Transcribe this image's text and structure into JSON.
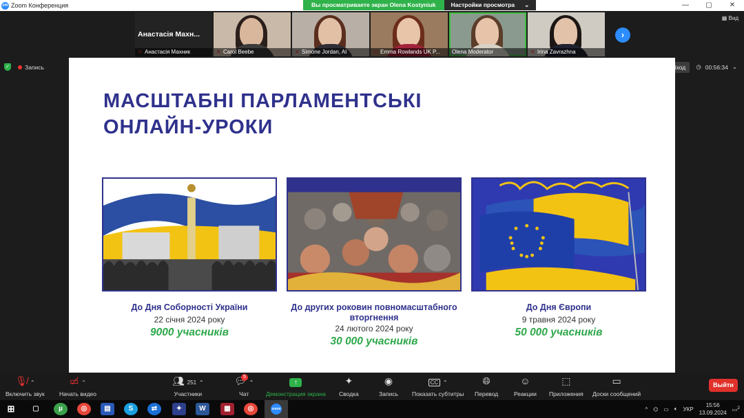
{
  "window": {
    "title": "Zoom Конференция",
    "controls": [
      "—",
      "▢",
      "✕"
    ]
  },
  "share_banner": {
    "viewing": "Вы просматриваете экран Olena Kostyniuk",
    "settings": "Настройки просмотра"
  },
  "gallery": {
    "host_card": "Анастасія Махн...",
    "tiles": [
      {
        "name": "Анастасія Махник",
        "muted": true
      },
      {
        "name": "Carol Beebe",
        "muted": true
      },
      {
        "name": "Simone Jordan, AI",
        "muted": true
      },
      {
        "name": "Emma Rowlands UK P...",
        "muted": true
      },
      {
        "name": "Olena Moderator",
        "muted": false
      },
      {
        "name": "Irina Zavrazhna",
        "muted": true
      }
    ],
    "next_icon": "chevron-right-icon"
  },
  "view_label": "Вид",
  "recording_label": "Запись",
  "tooltip": "Вход",
  "timer": "00:56:34",
  "slide": {
    "title_line1": "МАСШТАБНІ ПАРЛАМЕНТСЬКІ",
    "title_line2": "ОНЛАЙН-УРОКИ",
    "cards": [
      {
        "title": "До Дня Соборності України",
        "date": "22 січня 2024 року",
        "count": "9000 учасників"
      },
      {
        "title": "До других роковин повномасштабного вторгнення",
        "date": "24 лютого 2024 року",
        "count": "30 000 учасників"
      },
      {
        "title": "До Дня Європи",
        "date": "9 травня 2024 року",
        "count": "50 000 учасників"
      }
    ]
  },
  "toolbar": {
    "audio": "Включить звук",
    "video": "Начать видео",
    "participants": "Участники",
    "participants_count": "251",
    "chat": "Чат",
    "chat_badge": "5",
    "share": "Демонстрация экрана",
    "summary": "Сводка",
    "record": "Запись",
    "captions": "Показать субтитры",
    "captions_icon_text": "CC",
    "translate": "Перевод",
    "reactions": "Реакции",
    "apps": "Приложения",
    "boards": "Доски сообщений",
    "leave": "Выйти"
  },
  "taskbar": {
    "lang": "УКР",
    "time": "15:56",
    "date": "13.09.2024",
    "notifications": "2",
    "zoom_label": "zoom",
    "word_label": "W",
    "skype_label": "S"
  },
  "colors": {
    "slide_blue": "#2f318c",
    "count_green": "#2ea84a",
    "leave_red": "#e0312b",
    "zoom_blue": "#2d8cff"
  }
}
